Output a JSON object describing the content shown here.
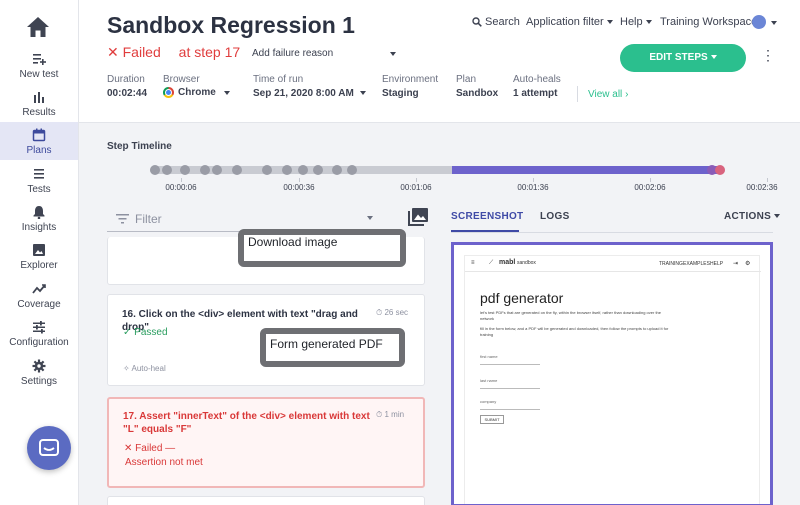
{
  "sidebar": {
    "items": [
      {
        "label": "New test",
        "icon": "new-test-icon"
      },
      {
        "label": "Results",
        "icon": "results-icon"
      },
      {
        "label": "Plans",
        "icon": "plans-icon"
      },
      {
        "label": "Tests",
        "icon": "tests-icon"
      },
      {
        "label": "Insights",
        "icon": "insights-icon"
      },
      {
        "label": "Explorer",
        "icon": "explorer-icon"
      },
      {
        "label": "Coverage",
        "icon": "coverage-icon"
      },
      {
        "label": "Configuration",
        "icon": "configuration-icon"
      },
      {
        "label": "Settings",
        "icon": "settings-icon"
      }
    ],
    "active": "Plans"
  },
  "header": {
    "title": "Sandbox Regression 1",
    "search_label": "Search",
    "app_filter_label": "Application filter",
    "help_label": "Help",
    "workspace_label": "Training Workspace",
    "status_text": "Failed",
    "step_text": "at step 17",
    "failure_reason_placeholder": "Add failure reason",
    "edit_steps_label": "EDIT STEPS",
    "view_all_label": "View all"
  },
  "meta": {
    "duration": {
      "label": "Duration",
      "value": "00:02:44"
    },
    "browser": {
      "label": "Browser",
      "value": "Chrome"
    },
    "time_of_run": {
      "label": "Time of run",
      "value": "Sep 21, 2020 8:00 AM"
    },
    "environment": {
      "label": "Environment",
      "value": "Staging"
    },
    "plan": {
      "label": "Plan",
      "value": "Sandbox"
    },
    "auto_heals": {
      "label": "Auto-heals",
      "value": "1 attempt"
    }
  },
  "timeline": {
    "title": "Step Timeline",
    "ticks": [
      "00:00:06",
      "00:00:36",
      "00:01:06",
      "00:01:36",
      "00:02:06",
      "00:02:36"
    ]
  },
  "filter": {
    "placeholder": "Filter"
  },
  "steps": {
    "prev_thumb_text": "Download image",
    "step16": {
      "title": "16. Click on the <div> element with text \"drag and drop\"",
      "time": "26 sec",
      "status": "Passed",
      "thumb_text": "Form generated PDF",
      "autoheal": "Auto-heal"
    },
    "step17": {
      "title": "17. Assert \"innerText\" of the <div> element with text \"L\" equals \"F\"",
      "time": "1 min",
      "status": "Failed —",
      "reason": "Assertion not met"
    }
  },
  "panel": {
    "tab_screenshot": "SCREENSHOT",
    "tab_logs": "LOGS",
    "actions_label": "ACTIONS"
  },
  "screenshot": {
    "brand": "mabl",
    "brand_sub": "sandbox",
    "nav": [
      "TRAINING",
      "EXAMPLES",
      "HELP"
    ],
    "heading": "pdf generator",
    "para1": "let's test PDFs that are generated on the fly, within the browser itself, rather than downloading over the network",
    "para2": "fill in the form below, and a PDF will be generated and downloaded, then follow the prompts to upload it for training",
    "field1": "first name",
    "field2": "last name",
    "field3": "company",
    "submit": "SUBMIT"
  },
  "colors": {
    "accent": "#6d62cc",
    "success": "#2bbf8e",
    "error": "#e03d3d",
    "active_nav_bg": "#e4e6f5"
  }
}
